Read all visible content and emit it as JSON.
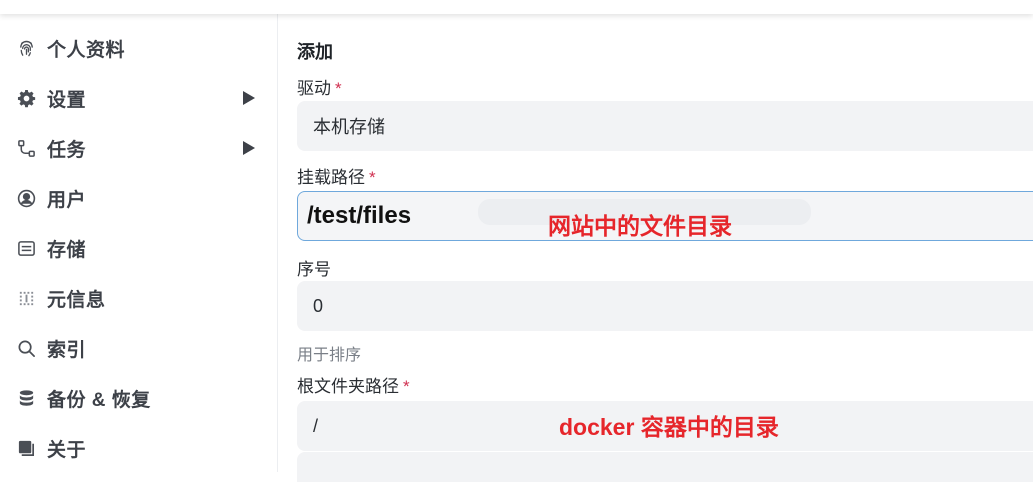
{
  "sidebar": {
    "items": [
      {
        "label": "个人资料",
        "icon": "fingerprint-icon",
        "has_submenu": false
      },
      {
        "label": "设置",
        "icon": "gear-icon",
        "has_submenu": true
      },
      {
        "label": "任务",
        "icon": "flow-icon",
        "has_submenu": true
      },
      {
        "label": "用户",
        "icon": "user-circle-icon",
        "has_submenu": false
      },
      {
        "label": "存储",
        "icon": "storage-icon",
        "has_submenu": false
      },
      {
        "label": "元信息",
        "icon": "meta-grid-icon",
        "has_submenu": false
      },
      {
        "label": "索引",
        "icon": "search-icon",
        "has_submenu": false
      },
      {
        "label": "备份 & 恢复",
        "icon": "database-icon",
        "has_submenu": false
      },
      {
        "label": "关于",
        "icon": "info-square-icon",
        "has_submenu": false
      }
    ]
  },
  "form": {
    "title": "添加",
    "required_mark": "*",
    "driver": {
      "label": "驱动",
      "value": "本机存储"
    },
    "mount_path": {
      "label": "挂载路径",
      "value": "/test/files"
    },
    "order": {
      "label": "序号",
      "value": "0",
      "hint": "用于排序"
    },
    "root_folder": {
      "label": "根文件夹路径",
      "value": "/"
    }
  },
  "annotations": {
    "mount_note": "网站中的文件目录",
    "root_note": "docker 容器中的目录"
  },
  "colors": {
    "required": "#d03050",
    "annotation": "#e6262b",
    "focus_border": "#6fa8dc",
    "input_bg": "#f2f3f5"
  }
}
